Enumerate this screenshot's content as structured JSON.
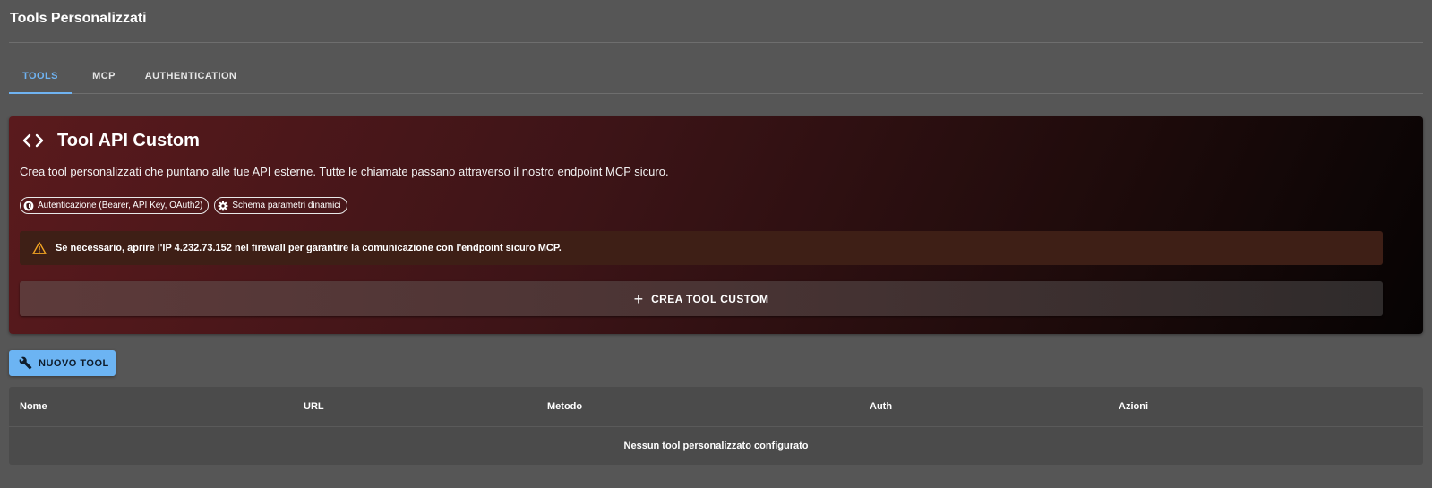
{
  "page": {
    "title": "Tools Personalizzati"
  },
  "tabs": [
    {
      "label": "TOOLS",
      "active": true
    },
    {
      "label": "MCP",
      "active": false
    },
    {
      "label": "AUTHENTICATION",
      "active": false
    }
  ],
  "card": {
    "icon": "code-brackets-icon",
    "title": "Tool API Custom",
    "description": "Crea tool personalizzati che puntano alle tue API esterne. Tutte le chiamate passano attraverso il nostro endpoint MCP sicuro.",
    "chips": [
      {
        "icon": "shield-icon",
        "label": "Autenticazione (Bearer, API Key, OAuth2)"
      },
      {
        "icon": "gear-icon",
        "label": "Schema parametri dinamici"
      }
    ],
    "alert": {
      "icon": "warning-icon",
      "text": "Se necessario, aprire l'IP 4.232.73.152 nel firewall per garantire la comunicazione con l'endpoint sicuro MCP."
    },
    "create_button": {
      "icon": "plus-icon",
      "label": "CREA TOOL CUSTOM"
    }
  },
  "new_tool_button": {
    "icon": "wrench-icon",
    "label": "NUOVO TOOL"
  },
  "table": {
    "columns": [
      "Nome",
      "URL",
      "Metodo",
      "Auth",
      "Azioni"
    ],
    "empty_message": "Nessun tool personalizzato configurato"
  },
  "colors": {
    "background": "#565656",
    "accent": "#6fb3f2",
    "button_primary": "#6cb4f3",
    "warning": "#f5a623"
  }
}
